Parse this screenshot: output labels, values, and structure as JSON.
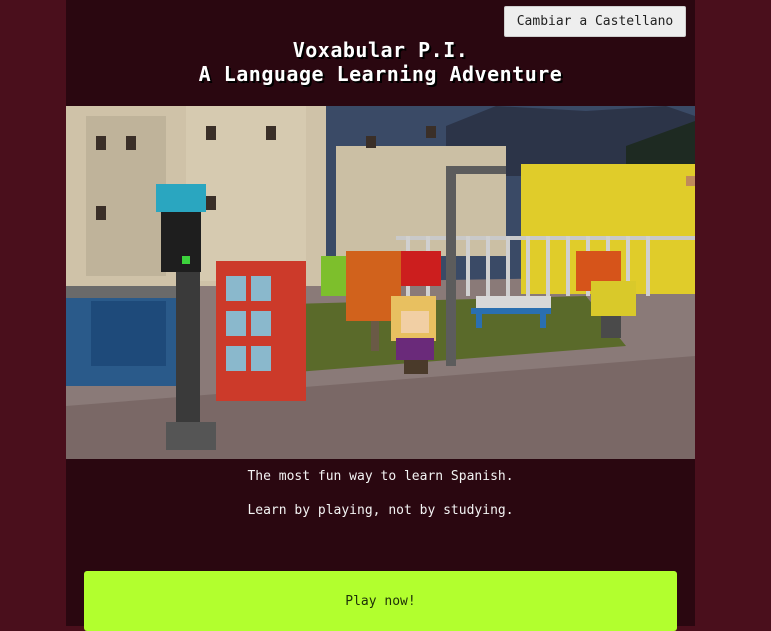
{
  "header": {
    "language_button": "Cambiar a Castellano",
    "title_line1": "Voxabular P.I.",
    "title_line2": "A Language Learning Adventure"
  },
  "hero": {
    "icon": "voxel-town-scene"
  },
  "content": {
    "tagline1": "The most fun way to learn Spanish.",
    "tagline2": "Learn by playing, not by studying.",
    "play_button": "Play now!"
  },
  "colors": {
    "page_background": "#4a0f1c",
    "column_background": "#2a0710",
    "play_button": "#b2ff2e"
  }
}
